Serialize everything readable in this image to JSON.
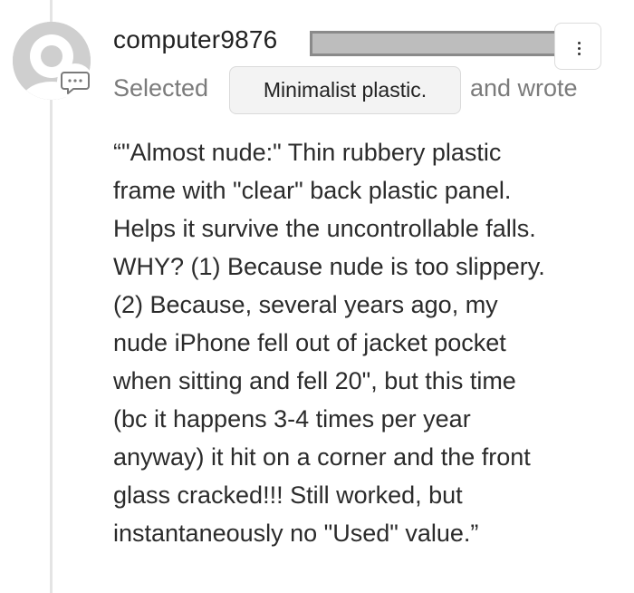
{
  "comment": {
    "username": "computer9876",
    "selected_label": "Selected",
    "selected_choice": "Minimalist plastic.",
    "wrote_label": "and wrote",
    "body_lines": [
      "“\"Almost nude:\" Thin rubbery plastic",
      "frame with \"clear\" back plastic panel.",
      "Helps it survive the uncontrollable falls.",
      "WHY? (1) Because nude is too slippery.",
      "(2) Because, several years ago, my",
      "nude iPhone fell out of jacket pocket",
      "when sitting and fell 20\", but this time",
      "(bc it happens 3-4 times per year",
      "anyway) it hit on a corner and the front",
      "glass cracked!!! Still worked, but",
      "instantaneously no \"Used\" value.”"
    ]
  },
  "icons": {
    "avatar": "default-user-avatar-icon",
    "badge": "comment-bubble-icon",
    "menu": "more-options-icon"
  },
  "colors": {
    "muted_text": "#7b7b7b",
    "body_text": "#2b2b2b",
    "chip_bg": "#f3f3f3",
    "avatar_bg": "#cfcfcf",
    "redaction": "#bdbdbd"
  }
}
